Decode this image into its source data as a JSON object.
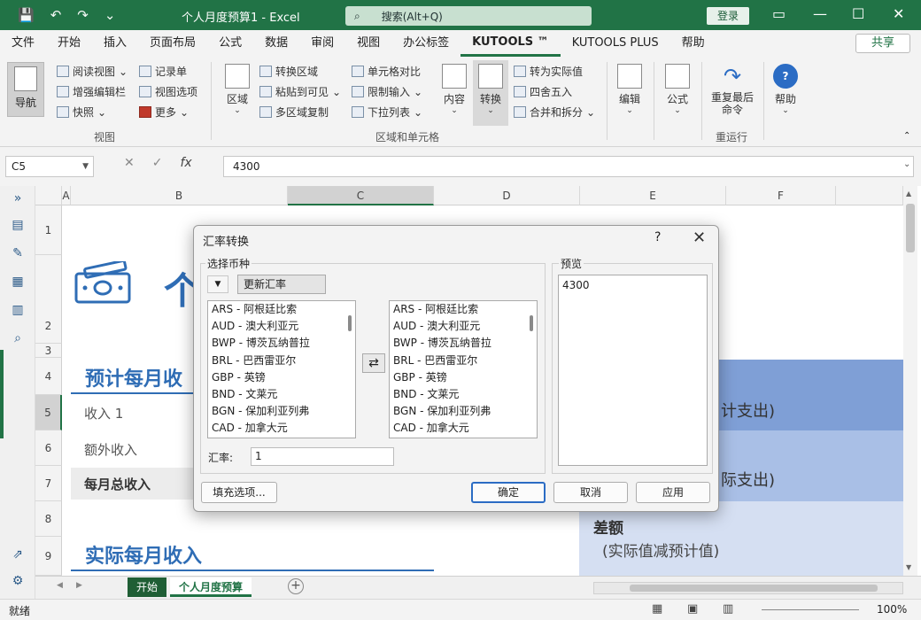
{
  "app": {
    "doc_title": "个人月度预算1  -  Excel",
    "search_placeholder": "搜索(Alt+Q)",
    "login": "登录",
    "share": "共享"
  },
  "menu": {
    "tabs": [
      "文件",
      "开始",
      "插入",
      "页面布局",
      "公式",
      "数据",
      "审阅",
      "视图",
      "办公标签",
      "KUTOOLS ™",
      "KUTOOLS PLUS",
      "帮助"
    ],
    "active_index": 9
  },
  "ribbon": {
    "nav": "导航",
    "view_items": [
      "阅读视图",
      "增强编辑栏",
      "快照",
      "记录单",
      "视图选项",
      "更多"
    ],
    "view_group": "视图",
    "range_big": "区域",
    "range_items": [
      "转换区域",
      "粘贴到可见",
      "多区域复制",
      "单元格对比",
      "限制输入",
      "下拉列表"
    ],
    "content": "内容",
    "convert": "转换",
    "convert_items": [
      "转为实际值",
      "四舍五入",
      "合并和拆分"
    ],
    "cells_group": "区域和单元格",
    "edit": "编辑",
    "formula": "公式",
    "repeat": "重复最后命令",
    "repeat_group": "重运行",
    "help": "帮助"
  },
  "formula_bar": {
    "name_box": "C5",
    "fx": "fx",
    "value": "4300"
  },
  "sheet": {
    "columns": [
      "A",
      "B",
      "C",
      "D",
      "E",
      "F"
    ],
    "rows": [
      "1",
      "2",
      "3",
      "4",
      "5",
      "6",
      "7",
      "8",
      "9"
    ],
    "title_char": "个",
    "heading_expected": "预计每月收",
    "income1": "收入 1",
    "extra_income": "额外收入",
    "total_income": "每月总收入",
    "heading_actual": "实际每月收入",
    "right_1": "计支出)",
    "right_2": "际支出)",
    "diff_title": "差额",
    "diff_sub": "(实际值减预计值)"
  },
  "sheet_tabs": [
    "开始",
    "个人月度预算"
  ],
  "status": {
    "ready": "就绪",
    "zoom": "100%"
  },
  "dialog": {
    "title": "汇率转换",
    "help": "?",
    "select_currency": "选择币种",
    "update_rates": "更新汇率",
    "currencies": [
      "ARS - 阿根廷比索",
      "AUD - 澳大利亚元",
      "BWP - 博茨瓦纳普拉",
      "BRL - 巴西雷亚尔",
      "GBP - 英镑",
      "BND - 文莱元",
      "BGN - 保加利亚列弗",
      "CAD - 加拿大元"
    ],
    "rate_label": "汇率:",
    "rate_value": "1",
    "preview_label": "预览",
    "preview_value": "4300",
    "fill_options": "填充选项...",
    "ok": "确定",
    "cancel": "取消",
    "apply": "应用"
  },
  "colors": {
    "excel_green": "#217346",
    "heading_blue": "#2f6db5",
    "band_dark": "#7f9fd6",
    "band_mid": "#a9bfe6",
    "band_light": "#d5dff2"
  }
}
